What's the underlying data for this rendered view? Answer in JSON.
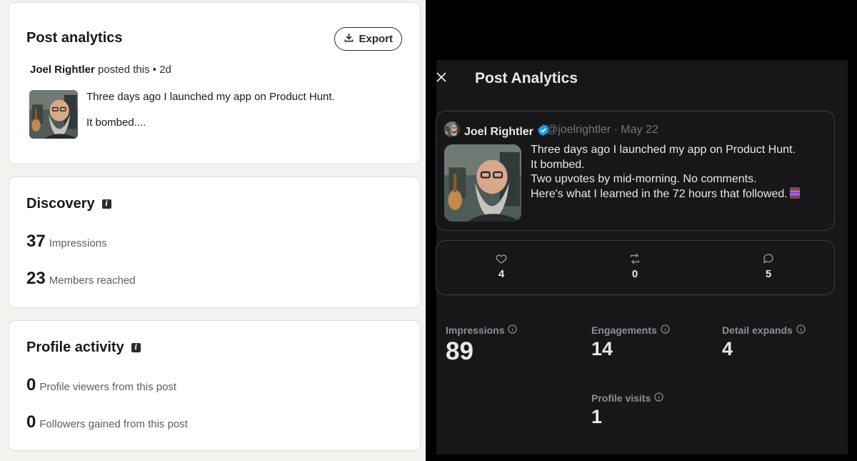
{
  "linkedin": {
    "title": "Post analytics",
    "export_label": "Export",
    "author": "Joel Rightler",
    "posted_suffix": "posted this",
    "time_ago": "2d",
    "post_lines": [
      "Three days ago I launched my app on Product Hunt.",
      "It bombed...."
    ],
    "discovery": {
      "title": "Discovery",
      "impressions": {
        "value": "37",
        "label": "Impressions"
      },
      "members_reached": {
        "value": "23",
        "label": "Members reached"
      }
    },
    "profile_activity": {
      "title": "Profile activity",
      "profile_viewers": {
        "value": "0",
        "label": "Profile viewers from this post"
      },
      "followers_gained": {
        "value": "0",
        "label": "Followers gained from this post"
      }
    }
  },
  "x": {
    "title": "Post Analytics",
    "author": "Joel Rightler",
    "handle_date": "@joelrightler · May 22",
    "post_lines": [
      "Three days ago I launched my app on Product Hunt.",
      "It bombed.",
      "Two upvotes by mid-morning. No comments.",
      "Here's what I learned in the 72 hours that followed."
    ],
    "engagement": {
      "likes": "4",
      "reposts": "0",
      "replies": "5"
    },
    "stats": {
      "impressions": {
        "label": "Impressions",
        "value": "89"
      },
      "engagements": {
        "label": "Engagements",
        "value": "14"
      },
      "detail_expands": {
        "label": "Detail expands",
        "value": "4"
      },
      "profile_visits": {
        "label": "Profile visits",
        "value": "1"
      }
    }
  },
  "colors": {
    "verified_blue": "#1d9bf0",
    "x_background": "#17171a",
    "linkedin_background": "#f4f2ee"
  },
  "icons": [
    "export-icon",
    "info-icon",
    "close-icon",
    "verified-badge-icon",
    "heart-icon",
    "repost-icon",
    "reply-icon",
    "spool-emoji"
  ]
}
